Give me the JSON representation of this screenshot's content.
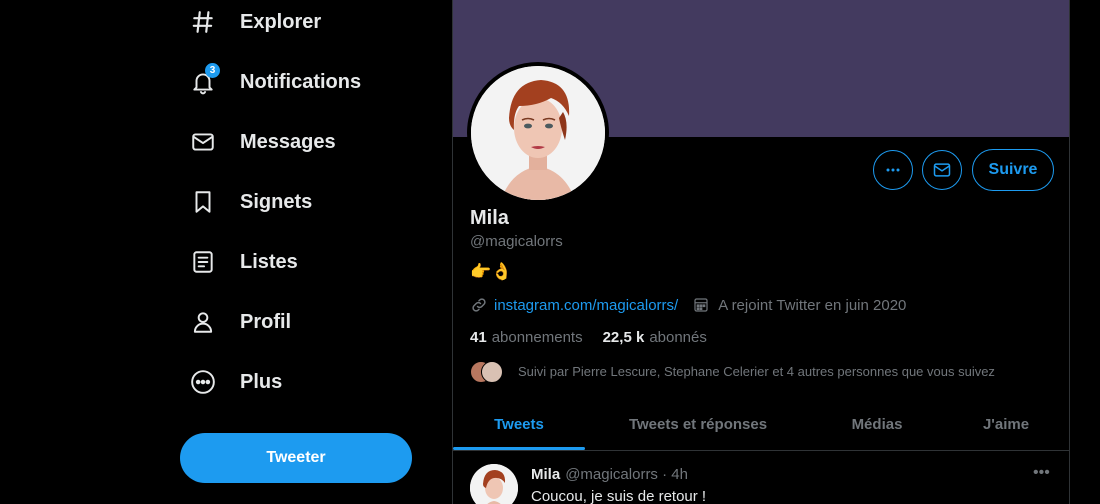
{
  "sidebar": {
    "items": [
      {
        "label": "Explorer",
        "icon": "hashtag-icon"
      },
      {
        "label": "Notifications",
        "icon": "bell-icon",
        "badge": "3"
      },
      {
        "label": "Messages",
        "icon": "envelope-icon"
      },
      {
        "label": "Signets",
        "icon": "bookmark-icon"
      },
      {
        "label": "Listes",
        "icon": "list-icon"
      },
      {
        "label": "Profil",
        "icon": "person-icon"
      },
      {
        "label": "Plus",
        "icon": "more-circle-icon"
      }
    ],
    "tweet_button": "Tweeter"
  },
  "profile": {
    "name": "Mila",
    "handle": "@magicalorrs",
    "bio": "👉👌",
    "link": "instagram.com/magicalorrs/",
    "joined": "A rejoint Twitter en juin 2020",
    "following_count": "41",
    "following_label": "abonnements",
    "followers_count": "22,5 k",
    "followers_label": "abonnés",
    "followed_by": "Suivi par Pierre Lescure, Stephane Celerier et 4 autres personnes que vous suivez",
    "follow_button": "Suivre",
    "banner_color": "#433a5f"
  },
  "tabs": [
    {
      "label": "Tweets",
      "active": true
    },
    {
      "label": "Tweets et réponses",
      "active": false
    },
    {
      "label": "Médias",
      "active": false
    },
    {
      "label": "J'aime",
      "active": false
    }
  ],
  "tweet": {
    "name": "Mila",
    "meta": "@magicalorrs · 4h",
    "text": "Coucou, je suis de retour !"
  },
  "colors": {
    "accent": "#1d9bf0",
    "background": "#000000",
    "muted_text": "#71767b"
  }
}
